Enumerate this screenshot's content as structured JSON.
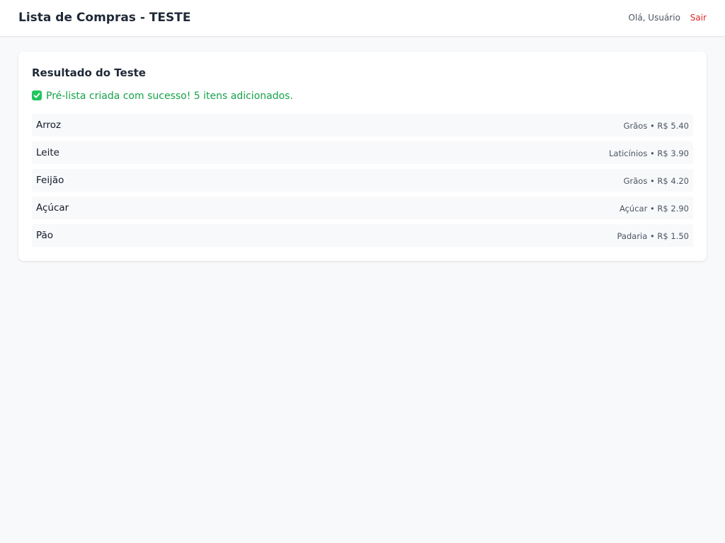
{
  "header": {
    "title": "Lista de Compras - TESTE",
    "greeting": "Olá, Usuário",
    "logout_label": "Sair"
  },
  "result": {
    "title": "Resultado do Teste",
    "icon": "check-icon",
    "message": "Pré-lista criada com sucesso! 5 itens adicionados.",
    "items": [
      {
        "name": "Arroz",
        "category": "Grãos",
        "price": "R$ 5.40"
      },
      {
        "name": "Leite",
        "category": "Laticínios",
        "price": "R$ 3.90"
      },
      {
        "name": "Feijão",
        "category": "Grãos",
        "price": "R$ 4.20"
      },
      {
        "name": "Açúcar",
        "category": "Açúcar",
        "price": "R$ 2.90"
      },
      {
        "name": "Pão",
        "category": "Padaria",
        "price": "R$ 1.50"
      }
    ]
  },
  "colors": {
    "success": "#16a34a",
    "logout": "#dc2626",
    "background": "#f8f9fb"
  }
}
